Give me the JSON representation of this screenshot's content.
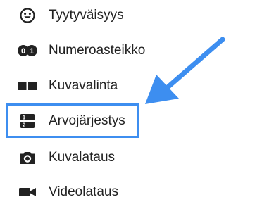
{
  "menu": {
    "items": [
      {
        "id": "satisfaction",
        "label": "Tyytyväisyys",
        "icon": "smiley-icon"
      },
      {
        "id": "number-scale",
        "label": "Numeroasteikko",
        "icon": "number-scale-icon"
      },
      {
        "id": "image-choice",
        "label": "Kuvavalinta",
        "icon": "image-choice-icon"
      },
      {
        "id": "ranking",
        "label": "Arvojärjestys",
        "icon": "ranking-icon"
      },
      {
        "id": "image-upload",
        "label": "Kuvalataus",
        "icon": "camera-icon"
      },
      {
        "id": "video-upload",
        "label": "Videolataus",
        "icon": "video-camera-icon"
      }
    ],
    "highlighted": "ranking"
  },
  "colors": {
    "highlight": "#3d8ef0",
    "arrow": "#3d8ef0",
    "icon": "#222222",
    "text": "#222222"
  }
}
